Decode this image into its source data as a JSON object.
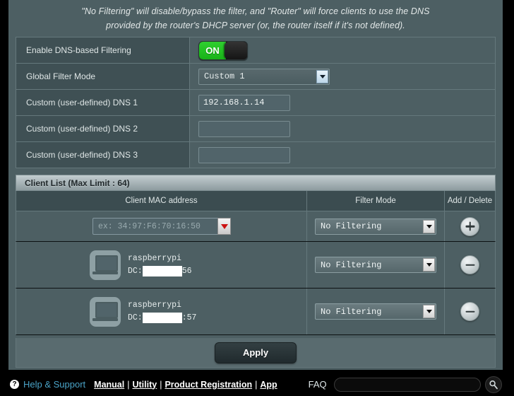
{
  "notice": {
    "line1": "\"No Filtering\" will disable/bypass the filter, and \"Router\" will force clients to use the DNS",
    "line2": "provided by the router's DHCP server (or, the router itself if it's not defined)."
  },
  "settings": {
    "rows": [
      {
        "label": "Enable DNS-based Filtering",
        "type": "toggle",
        "value": "ON"
      },
      {
        "label": "Global Filter Mode",
        "type": "select",
        "value": "Custom 1"
      },
      {
        "label": "Custom (user-defined) DNS 1",
        "type": "text",
        "value": "192.168.1.14",
        "placeholder": ""
      },
      {
        "label": "Custom (user-defined) DNS 2",
        "type": "text",
        "value": "",
        "placeholder": ""
      },
      {
        "label": "Custom (user-defined) DNS 3",
        "type": "text",
        "value": "",
        "placeholder": ""
      }
    ]
  },
  "client_list": {
    "title": "Client List (Max Limit : 64)",
    "columns": {
      "mac": "Client MAC address",
      "filter_mode": "Filter Mode",
      "add_delete": "Add / Delete"
    },
    "input_row": {
      "mac_placeholder": "ex: 34:97:F6:70:16:50",
      "filter_mode": "No Filtering",
      "action": "add"
    },
    "devices": [
      {
        "name": "raspberrypi",
        "mac_prefix": "DC:",
        "mac_suffix": "56",
        "mac_redacted": true,
        "filter_mode": "No Filtering",
        "action": "delete",
        "icon": "computer-icon"
      },
      {
        "name": "raspberrypi",
        "mac_prefix": "DC:",
        "mac_suffix": ":57",
        "mac_redacted": true,
        "filter_mode": "No Filtering",
        "action": "delete",
        "icon": "computer-icon"
      }
    ]
  },
  "apply": {
    "label": "Apply"
  },
  "footer": {
    "help_icon": "?",
    "help_label": "Help & Support",
    "links": [
      {
        "label": "Manual"
      },
      {
        "label": "Utility"
      },
      {
        "label": "Product Registration"
      },
      {
        "label": "App"
      }
    ],
    "separator": "|",
    "faq_label": "FAQ",
    "faq_value": "",
    "faq_placeholder": ""
  },
  "colors": {
    "panel_bg": "#4d5f63",
    "label_bg": "#3f5054",
    "border": "#65787c",
    "toggle_on": "#22bb22",
    "accent_link": "#4aa3c7",
    "mac_arrow": "#cc1111"
  }
}
